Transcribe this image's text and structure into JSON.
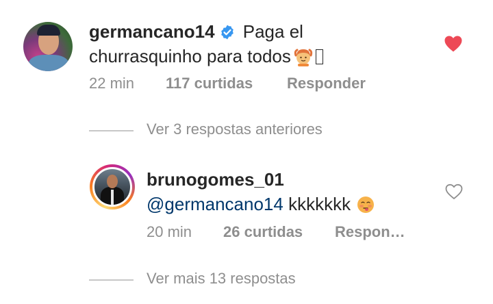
{
  "comment": {
    "username": "germancano14",
    "text": "Paga el churrasquinho para todos",
    "emoji_name": "person-gesturing-ok-emoji",
    "time": "22 min",
    "likes": "117 curtidas",
    "reply_label": "Responder",
    "liked": true,
    "verified": true
  },
  "previous_replies_toggle": {
    "label": "Ver 3 respostas anteriores"
  },
  "reply": {
    "username": "brunogomes_01",
    "mention": "@germancano14",
    "text": "kkkkkkk",
    "emoji_name": "face-with-tongue-emoji",
    "time": "20 min",
    "likes": "26 curtidas",
    "reply_label": "Respon…",
    "liked": false,
    "has_story_ring": true
  },
  "more_replies_toggle": {
    "label": "Ver mais 13 respostas"
  },
  "colors": {
    "text": "#262626",
    "secondary": "#8e8e8e",
    "mention": "#00376b",
    "verified_blue": "#3897f0",
    "like_red": "#ed4956"
  }
}
